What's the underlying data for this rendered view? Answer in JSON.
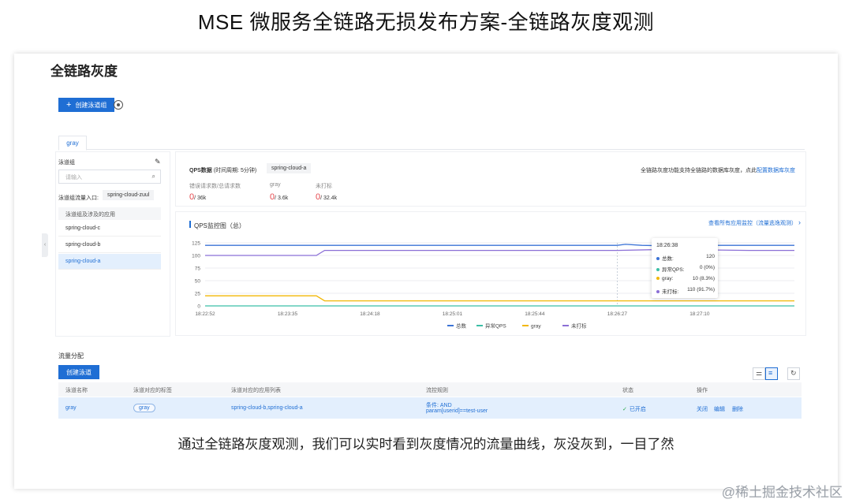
{
  "slide": {
    "title": "MSE 微服务全链路无损发布方案-全链路灰度观测",
    "caption": "通过全链路灰度观测，我们可以实时看到灰度情况的流量曲线，灰没灰到，一目了然",
    "watermark": "@稀土掘金技术社区"
  },
  "page": {
    "title": "全链路灰度",
    "create_lane_group_btn": "创建泳道组",
    "tab_label": "gray"
  },
  "sidebar": {
    "section_title": "泳道组",
    "search_placeholder": "请输入",
    "entry_label": "泳道组流量入口:",
    "entry_value": "spring-cloud-zuul",
    "apps_header": "泳道组及涉及的应用",
    "apps": [
      "spring-cloud-c",
      "spring-cloud-b",
      "spring-cloud-a"
    ]
  },
  "qps_panel": {
    "title": "QPS数据",
    "period": "(时间周期: 5分钟)",
    "app_chip": "spring-cloud-a",
    "note_prefix": "全链路灰度功能支持全链路的数据库灰度，点此",
    "note_link": "配置数据库灰度",
    "stats": [
      {
        "label": "错误请求数/总请求数",
        "value": "0",
        "total": "/ 36k"
      },
      {
        "label": "gray",
        "value": "0",
        "total": "/ 3.6k"
      },
      {
        "label": "未打标",
        "value": "0",
        "total": "/ 32.4k"
      }
    ]
  },
  "monitor": {
    "title": "QPS监控图（总）",
    "view_all_link": "查看所有应用监控（流量逃逸观测）",
    "tooltip": {
      "time": "18:26:38",
      "rows": [
        {
          "label": "总数:",
          "value": "120",
          "color": "#3b73d6"
        },
        {
          "label": "异常QPS:",
          "value": "0 (0%)",
          "color": "#3bbfa6"
        },
        {
          "label": "gray:",
          "value": "10 (8.3%)",
          "color": "#f2b705"
        },
        {
          "label": "未打标:",
          "value": "110 (91.7%)",
          "color": "#8b6fd6"
        }
      ]
    }
  },
  "chart_data": {
    "type": "line",
    "title": "QPS监控图（总）",
    "x": [
      "18:22:52",
      "18:23:35",
      "18:24:18",
      "18:25:01",
      "18:25:44",
      "18:26:27",
      "18:27:10"
    ],
    "ylim": [
      0,
      125
    ],
    "y_ticks": [
      "0",
      "25",
      "50",
      "75",
      "100",
      "125"
    ],
    "legend_position": "bottom",
    "series": [
      {
        "name": "总数",
        "color": "#3b73d6",
        "points": [
          [
            0,
            120
          ],
          [
            1.4,
            120
          ],
          [
            5.0,
            120
          ],
          [
            5.1,
            122
          ],
          [
            5.3,
            120
          ],
          [
            5.6,
            119
          ],
          [
            5.7,
            120
          ],
          [
            6.6,
            120
          ],
          [
            7.15,
            120
          ]
        ]
      },
      {
        "name": "异常QPS",
        "color": "#3bbfa6",
        "points": [
          [
            0,
            0
          ],
          [
            7.15,
            0
          ]
        ]
      },
      {
        "name": "gray",
        "color": "#f2b705",
        "points": [
          [
            0,
            20
          ],
          [
            1.35,
            20
          ],
          [
            1.45,
            10
          ],
          [
            5.0,
            10
          ],
          [
            5.6,
            10
          ],
          [
            6.6,
            10
          ],
          [
            7.15,
            10
          ]
        ]
      },
      {
        "name": "未打标",
        "color": "#8b6fd6",
        "points": [
          [
            0,
            100
          ],
          [
            1.35,
            100
          ],
          [
            1.45,
            110
          ],
          [
            5.0,
            110
          ],
          [
            5.6,
            112
          ],
          [
            6.6,
            110
          ],
          [
            7.15,
            110
          ]
        ]
      }
    ]
  },
  "traffic": {
    "section_title": "流量分配",
    "create_lane_btn": "创建泳道",
    "columns": [
      "泳道名称",
      "泳道对应的标签",
      "泳道对应的应用列表",
      "流控规则",
      "状态",
      "操作"
    ],
    "row": {
      "name": "gray",
      "tag": "gray",
      "apps": "spring-cloud-b,spring-cloud-a",
      "rule_line1": "条件: AND",
      "rule_line2": "param[userid]==test-user",
      "status": "已开启",
      "actions": [
        "关闭",
        "编辑",
        "删除"
      ]
    }
  }
}
